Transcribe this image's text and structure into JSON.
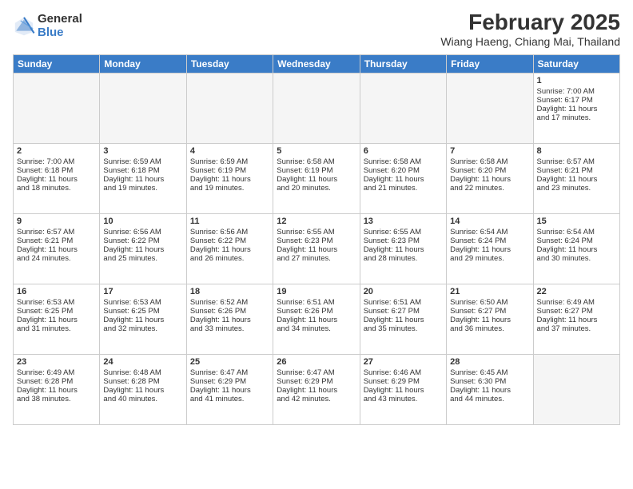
{
  "logo": {
    "general": "General",
    "blue": "Blue"
  },
  "header": {
    "month": "February 2025",
    "location": "Wiang Haeng, Chiang Mai, Thailand"
  },
  "weekdays": [
    "Sunday",
    "Monday",
    "Tuesday",
    "Wednesday",
    "Thursday",
    "Friday",
    "Saturday"
  ],
  "weeks": [
    [
      {
        "day": "",
        "info": ""
      },
      {
        "day": "",
        "info": ""
      },
      {
        "day": "",
        "info": ""
      },
      {
        "day": "",
        "info": ""
      },
      {
        "day": "",
        "info": ""
      },
      {
        "day": "",
        "info": ""
      },
      {
        "day": "1",
        "info": "Sunrise: 7:00 AM\nSunset: 6:17 PM\nDaylight: 11 hours\nand 17 minutes."
      }
    ],
    [
      {
        "day": "2",
        "info": "Sunrise: 7:00 AM\nSunset: 6:18 PM\nDaylight: 11 hours\nand 18 minutes."
      },
      {
        "day": "3",
        "info": "Sunrise: 6:59 AM\nSunset: 6:18 PM\nDaylight: 11 hours\nand 19 minutes."
      },
      {
        "day": "4",
        "info": "Sunrise: 6:59 AM\nSunset: 6:19 PM\nDaylight: 11 hours\nand 19 minutes."
      },
      {
        "day": "5",
        "info": "Sunrise: 6:58 AM\nSunset: 6:19 PM\nDaylight: 11 hours\nand 20 minutes."
      },
      {
        "day": "6",
        "info": "Sunrise: 6:58 AM\nSunset: 6:20 PM\nDaylight: 11 hours\nand 21 minutes."
      },
      {
        "day": "7",
        "info": "Sunrise: 6:58 AM\nSunset: 6:20 PM\nDaylight: 11 hours\nand 22 minutes."
      },
      {
        "day": "8",
        "info": "Sunrise: 6:57 AM\nSunset: 6:21 PM\nDaylight: 11 hours\nand 23 minutes."
      }
    ],
    [
      {
        "day": "9",
        "info": "Sunrise: 6:57 AM\nSunset: 6:21 PM\nDaylight: 11 hours\nand 24 minutes."
      },
      {
        "day": "10",
        "info": "Sunrise: 6:56 AM\nSunset: 6:22 PM\nDaylight: 11 hours\nand 25 minutes."
      },
      {
        "day": "11",
        "info": "Sunrise: 6:56 AM\nSunset: 6:22 PM\nDaylight: 11 hours\nand 26 minutes."
      },
      {
        "day": "12",
        "info": "Sunrise: 6:55 AM\nSunset: 6:23 PM\nDaylight: 11 hours\nand 27 minutes."
      },
      {
        "day": "13",
        "info": "Sunrise: 6:55 AM\nSunset: 6:23 PM\nDaylight: 11 hours\nand 28 minutes."
      },
      {
        "day": "14",
        "info": "Sunrise: 6:54 AM\nSunset: 6:24 PM\nDaylight: 11 hours\nand 29 minutes."
      },
      {
        "day": "15",
        "info": "Sunrise: 6:54 AM\nSunset: 6:24 PM\nDaylight: 11 hours\nand 30 minutes."
      }
    ],
    [
      {
        "day": "16",
        "info": "Sunrise: 6:53 AM\nSunset: 6:25 PM\nDaylight: 11 hours\nand 31 minutes."
      },
      {
        "day": "17",
        "info": "Sunrise: 6:53 AM\nSunset: 6:25 PM\nDaylight: 11 hours\nand 32 minutes."
      },
      {
        "day": "18",
        "info": "Sunrise: 6:52 AM\nSunset: 6:26 PM\nDaylight: 11 hours\nand 33 minutes."
      },
      {
        "day": "19",
        "info": "Sunrise: 6:51 AM\nSunset: 6:26 PM\nDaylight: 11 hours\nand 34 minutes."
      },
      {
        "day": "20",
        "info": "Sunrise: 6:51 AM\nSunset: 6:27 PM\nDaylight: 11 hours\nand 35 minutes."
      },
      {
        "day": "21",
        "info": "Sunrise: 6:50 AM\nSunset: 6:27 PM\nDaylight: 11 hours\nand 36 minutes."
      },
      {
        "day": "22",
        "info": "Sunrise: 6:49 AM\nSunset: 6:27 PM\nDaylight: 11 hours\nand 37 minutes."
      }
    ],
    [
      {
        "day": "23",
        "info": "Sunrise: 6:49 AM\nSunset: 6:28 PM\nDaylight: 11 hours\nand 38 minutes."
      },
      {
        "day": "24",
        "info": "Sunrise: 6:48 AM\nSunset: 6:28 PM\nDaylight: 11 hours\nand 40 minutes."
      },
      {
        "day": "25",
        "info": "Sunrise: 6:47 AM\nSunset: 6:29 PM\nDaylight: 11 hours\nand 41 minutes."
      },
      {
        "day": "26",
        "info": "Sunrise: 6:47 AM\nSunset: 6:29 PM\nDaylight: 11 hours\nand 42 minutes."
      },
      {
        "day": "27",
        "info": "Sunrise: 6:46 AM\nSunset: 6:29 PM\nDaylight: 11 hours\nand 43 minutes."
      },
      {
        "day": "28",
        "info": "Sunrise: 6:45 AM\nSunset: 6:30 PM\nDaylight: 11 hours\nand 44 minutes."
      },
      {
        "day": "",
        "info": ""
      }
    ]
  ]
}
